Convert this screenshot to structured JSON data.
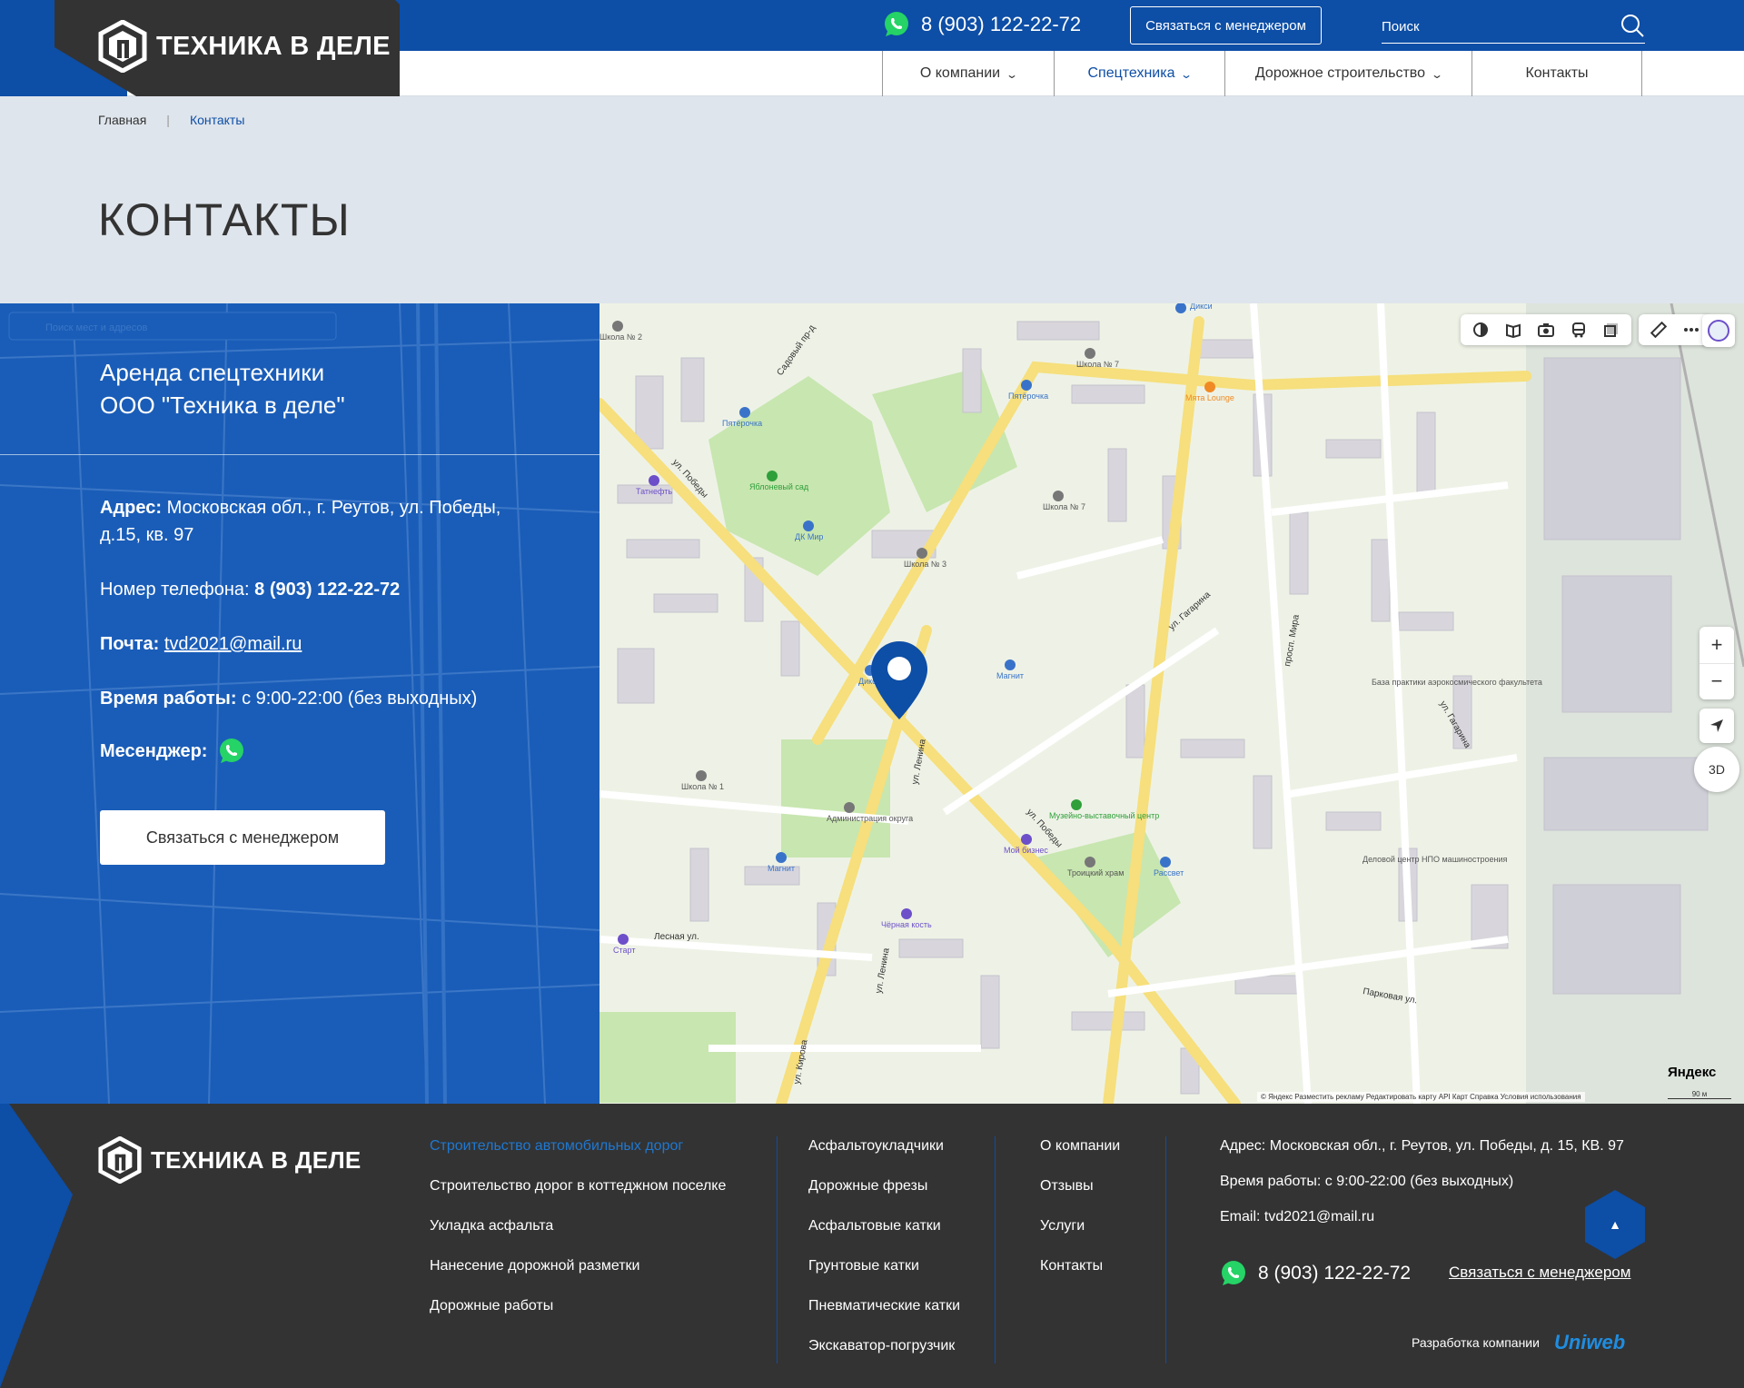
{
  "header": {
    "logo_text": "ТЕХНИКА В ДЕЛЕ",
    "phone": "8 (903) 122-22-72",
    "contact_button": "Связаться с менеджером",
    "search_placeholder": "Поиск",
    "menu": [
      {
        "label": "О компании",
        "has_dropdown": true
      },
      {
        "label": "Спецтехника",
        "has_dropdown": true,
        "active": true
      },
      {
        "label": "Дорожное строительство",
        "has_dropdown": true
      },
      {
        "label": "Контакты",
        "has_dropdown": false
      }
    ]
  },
  "breadcrumb": {
    "home": "Главная",
    "current": "Контакты"
  },
  "page_title": "КОНТАКТЫ",
  "contact_card": {
    "heading_line1": "Аренда спецтехники",
    "heading_line2": "ООО \"Техника в деле\"",
    "address_label": "Адрес:",
    "address_value": "Московская обл., г. Реутов, ул. Победы, д.15, кв. 97",
    "phone_label": "Номер телефона:",
    "phone_value": "8 (903) 122-22-72",
    "email_label": "Почта:",
    "email_value": "tvd2021@mail.ru",
    "hours_label": "Время работы:",
    "hours_value": "с 9:00-22:00 (без выходных)",
    "messenger_label": "Месенджер:",
    "button": "Связаться с менеджером"
  },
  "map": {
    "street_labels": [
      "ул. Победы",
      "ул. Победы",
      "ул. Ленина",
      "ул. Ленина",
      "просп. Мира",
      "ул. Гагарина",
      "ул. Гагарина",
      "Садовый пр-д",
      "Лесная ул.",
      "Парковая ул.",
      "ул. Кирова"
    ],
    "poi_labels": [
      "Пятёрочка",
      "Пятёрочка",
      "Яблоневый сад",
      "ДК Мир",
      "Школа № 3",
      "Школа № 7",
      "Школа № 7",
      "Школа № 2",
      "Школа № 1",
      "Дикси",
      "Магнит",
      "Магнит",
      "Мята Lounge",
      "Администрация округа",
      "Музейно-выставочный центр",
      "Мой бизнес",
      "Троицкий храм",
      "Рассвет",
      "Деловой центр НПО машиностроения",
      "База практики аэрокосмического факультета",
      "Татнефть",
      "Чёрная кость",
      "Старт",
      "Дикси"
    ],
    "zoom_in": "+",
    "zoom_out": "−",
    "btn_3d": "3D",
    "brand": "Яндекс",
    "attribution": "© Яндекс   Разместить рекламу   Редактировать карту   API Карт   Справка   Условия использования",
    "scale": "90 м",
    "bg_search_placeholder": "Поиск мест и адресов"
  },
  "footer": {
    "logo_text": "ТЕХНИКА В ДЕЛЕ",
    "col1": [
      "Строительство автомобильных дорог",
      "Строительство дорог в коттеджном поселке",
      "Укладка асфальта",
      "Нанесение дорожной разметки",
      "Дорожные работы"
    ],
    "col2": [
      "Асфальтоукладчики",
      "Дорожные фрезы",
      "Асфальтовые катки",
      "Грунтовые катки",
      "Пневматические катки",
      "Экскаватор-погрузчик"
    ],
    "col3": [
      "О компании",
      "Отзывы",
      "Услуги",
      "Контакты"
    ],
    "address": "Адрес: Московская обл., г. Реутов, ул. Победы, д. 15, КВ. 97",
    "hours": "Время работы:  с 9:00-22:00 (без выходных)",
    "email": "Email:  tvd2021@mail.ru",
    "phone": "8 (903) 122-22-72",
    "manager_link": "Связаться с менеджером",
    "up_arrow": "▲",
    "dev_label": "Разработка компании",
    "dev_brand": "Uniweb"
  },
  "colors": {
    "brand_blue": "#0d4ea6",
    "dark": "#333333",
    "hero_bg": "#dfe5ec",
    "whatsapp": "#25d366",
    "accent_link": "#1f78d1"
  }
}
